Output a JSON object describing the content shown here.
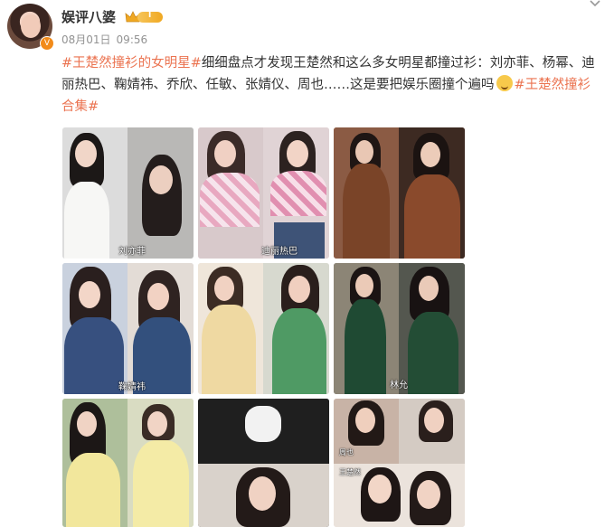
{
  "user": {
    "name": "娱评八婆",
    "verified_badge": "V",
    "vip_level": "I"
  },
  "post": {
    "date": "08月01日",
    "time": "09:56",
    "topic_tag": "#王楚然撞衫的女明星#",
    "text": "细细盘点才发现王楚然和这么多女明星都撞过衫：刘亦菲、杨幂、迪丽热巴、鞠婧祎、乔欣、任敏、张婧仪、周也……这是要把娱乐圈撞个遍吗",
    "emoji": "smile-emoji",
    "topic_tag2": "#王楚然撞衫合集#"
  },
  "images": [
    {
      "caption": "刘亦菲"
    },
    {
      "caption": "迪丽热巴"
    },
    {
      "caption": ""
    },
    {
      "caption": "鞠婧祎"
    },
    {
      "caption": ""
    },
    {
      "caption": "林允"
    },
    {
      "caption": ""
    },
    {
      "caption": ""
    },
    {
      "caption_a": "周也",
      "caption_b": "王楚然"
    }
  ],
  "colors": {
    "tag": "#eb7350",
    "text": "#333333",
    "meta": "#939393",
    "vip": "#f0a822"
  },
  "icons": [
    "chevron-down-icon",
    "crown-icon",
    "verified-icon"
  ]
}
